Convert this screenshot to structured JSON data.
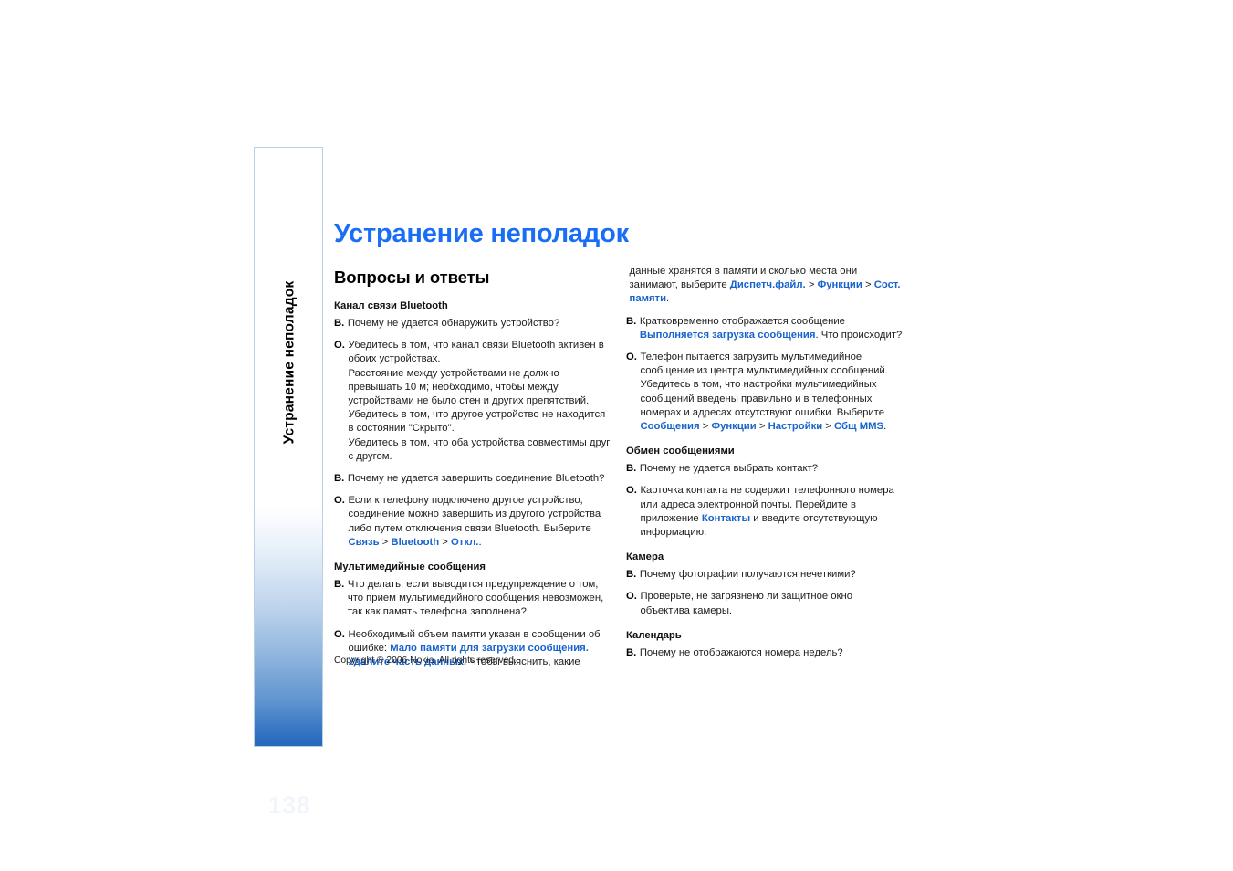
{
  "chapter_tab": {
    "vertical_label": "Устранение неполадок",
    "page_number": "138",
    "gradient_top_color": "#ffffff",
    "gradient_bottom_color": "#2569be",
    "border_color": "#b9cfe6"
  },
  "page": {
    "title": "Устранение неполадок",
    "title_color": "#1a6ef5",
    "link_color": "#1763cd",
    "copyright": "Copyright ® 2006 Nokia. All rights reserved."
  },
  "section": {
    "heading": "Вопросы и ответы"
  },
  "left_column": {
    "groups": [
      {
        "subhead": "Канал связи Bluetooth",
        "items": [
          {
            "marker": "В.",
            "paragraphs": [
              [
                {
                  "t": "Почему не удается обнаружить устройство?",
                  "link": false
                }
              ]
            ]
          },
          {
            "marker": "О.",
            "paragraphs": [
              [
                {
                  "t": "Убедитесь в том, что канал связи Bluetooth активен в обоих устройствах.",
                  "link": false
                }
              ],
              [
                {
                  "t": "Расстояние между устройствами не должно превышать 10 м; необходимо, чтобы между устройствами не было стен и других препятствий.",
                  "link": false
                }
              ],
              [
                {
                  "t": "Убедитесь в том, что другое устройство не находится в состоянии \"Скрыто\".",
                  "link": false
                }
              ],
              [
                {
                  "t": "Убедитесь в том, что оба устройства совместимы друг с другом.",
                  "link": false
                }
              ]
            ]
          },
          {
            "marker": "В.",
            "paragraphs": [
              [
                {
                  "t": "Почему не удается завершить соединение Bluetooth?",
                  "link": false
                }
              ]
            ]
          },
          {
            "marker": "О.",
            "paragraphs": [
              [
                {
                  "t": "Если к телефону подключено другое устройство, соединение можно завершить из другого устройства либо путем отключения связи Bluetooth. Выберите ",
                  "link": false
                },
                {
                  "t": "Связь",
                  "link": true
                },
                {
                  "t": " > ",
                  "link": false
                },
                {
                  "t": "Bluetooth",
                  "link": true
                },
                {
                  "t": " > ",
                  "link": false
                },
                {
                  "t": "Откл.",
                  "link": true
                },
                {
                  "t": ".",
                  "link": false
                }
              ]
            ]
          }
        ]
      },
      {
        "subhead": "Мультимедийные сообщения",
        "items": [
          {
            "marker": "В.",
            "paragraphs": [
              [
                {
                  "t": "Что делать, если выводится предупреждение о том, что прием мультимедийного сообщения невозможен, так как память телефона заполнена?",
                  "link": false
                }
              ]
            ]
          },
          {
            "marker": "О.",
            "paragraphs": [
              [
                {
                  "t": "Необходимый объем памяти указан в сообщении об ошибке: ",
                  "link": false
                },
                {
                  "t": "Мало памяти для загрузки сообщения. Удалите часть данных.",
                  "link": true
                },
                {
                  "t": " Чтобы выяснить, какие",
                  "link": false
                }
              ]
            ]
          }
        ]
      }
    ]
  },
  "right_column": {
    "groups": [
      {
        "subhead": "",
        "items": [
          {
            "marker": "",
            "paragraphs": [
              [
                {
                  "t": "данные хранятся в памяти и сколько места они занимают, выберите ",
                  "link": false
                },
                {
                  "t": "Диспетч.файл.",
                  "link": true
                },
                {
                  "t": " > ",
                  "link": false
                },
                {
                  "t": "Функции",
                  "link": true
                },
                {
                  "t": " > ",
                  "link": false
                },
                {
                  "t": "Сост. памяти",
                  "link": true
                },
                {
                  "t": ".",
                  "link": false
                }
              ]
            ]
          },
          {
            "marker": "В.",
            "paragraphs": [
              [
                {
                  "t": "Кратковременно отображается сообщение ",
                  "link": false
                },
                {
                  "t": "Выполняется загрузка сообщения",
                  "link": true
                },
                {
                  "t": ". Что происходит?",
                  "link": false
                }
              ]
            ]
          },
          {
            "marker": "О.",
            "paragraphs": [
              [
                {
                  "t": "Телефон пытается загрузить мультимедийное сообщение из центра мультимедийных сообщений. Убедитесь в том, что настройки мультимедийных сообщений введены правильно и в телефонных номерах и адресах отсутствуют ошибки. Выберите ",
                  "link": false
                },
                {
                  "t": "Сообщения",
                  "link": true
                },
                {
                  "t": " > ",
                  "link": false
                },
                {
                  "t": "Функции",
                  "link": true
                },
                {
                  "t": " > ",
                  "link": false
                },
                {
                  "t": "Настройки",
                  "link": true
                },
                {
                  "t": " > ",
                  "link": false
                },
                {
                  "t": "Сбщ MMS",
                  "link": true
                },
                {
                  "t": ".",
                  "link": false
                }
              ]
            ]
          }
        ]
      },
      {
        "subhead": "Обмен сообщениями",
        "items": [
          {
            "marker": "В.",
            "paragraphs": [
              [
                {
                  "t": "Почему не удается выбрать контакт?",
                  "link": false
                }
              ]
            ]
          },
          {
            "marker": "О.",
            "paragraphs": [
              [
                {
                  "t": "Карточка контакта не содержит телефонного номера или адреса электронной почты. Перейдите в приложение ",
                  "link": false
                },
                {
                  "t": "Контакты",
                  "link": true
                },
                {
                  "t": " и введите отсутствующую информацию.",
                  "link": false
                }
              ]
            ]
          }
        ]
      },
      {
        "subhead": "Камера",
        "items": [
          {
            "marker": "В.",
            "paragraphs": [
              [
                {
                  "t": "Почему фотографии получаются нечеткими?",
                  "link": false
                }
              ]
            ]
          },
          {
            "marker": "О.",
            "paragraphs": [
              [
                {
                  "t": "Проверьте, не загрязнено ли защитное окно объектива камеры.",
                  "link": false
                }
              ]
            ]
          }
        ]
      },
      {
        "subhead": "Календарь",
        "items": [
          {
            "marker": "В.",
            "paragraphs": [
              [
                {
                  "t": "Почему не отображаются номера недель?",
                  "link": false
                }
              ]
            ]
          }
        ]
      }
    ]
  }
}
